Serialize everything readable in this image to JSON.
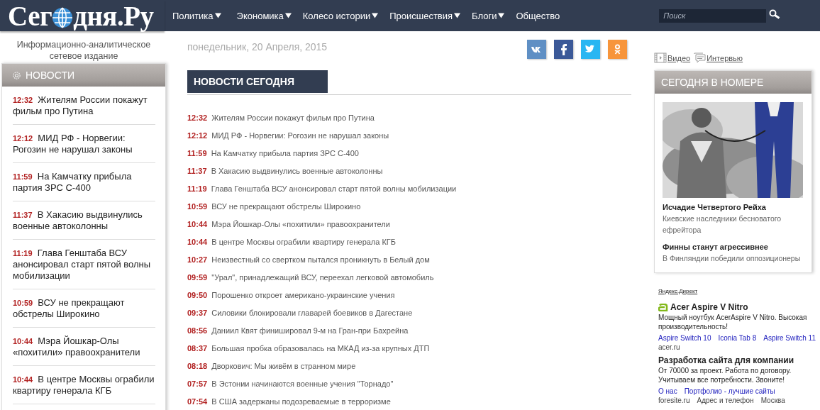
{
  "header": {
    "logo": {
      "before": "Сег",
      "after": "дня.Ру"
    },
    "nav": [
      {
        "label": "Политика",
        "dropdown": true
      },
      {
        "label": "Экономика",
        "dropdown": true
      },
      {
        "label": "Колесо истории",
        "dropdown": true
      },
      {
        "label": "Происшествия",
        "dropdown": true
      },
      {
        "label": "Блоги",
        "dropdown": true
      },
      {
        "label": "Общество",
        "dropdown": false
      }
    ],
    "search": {
      "placeholder": "Поиск"
    }
  },
  "tagline": "Информационно-аналитическое сетевое издание",
  "sidebar": {
    "title": "НОВОСТИ",
    "items": [
      {
        "time": "12:32",
        "title": "Жителям России покажут фильм про Путина"
      },
      {
        "time": "12:12",
        "title": "МИД РФ - Норвегии: Рогозин не нарушал законы"
      },
      {
        "time": "11:59",
        "title": "На Камчатку прибыла партия ЗРС С-400"
      },
      {
        "time": "11:37",
        "title": "В Хакасию выдвинулись военные автоколонны"
      },
      {
        "time": "11:19",
        "title": "Глава Генштаба ВСУ анонсировал старт пятой волны мобилизации"
      },
      {
        "time": "10:59",
        "title": "ВСУ не прекращают обстрелы Широкино"
      },
      {
        "time": "10:44",
        "title": "Мэра Йошкар-Олы «похитили» правоохранители"
      },
      {
        "time": "10:44",
        "title": "В центре Москвы ограбили квартиру генерала КГБ"
      }
    ]
  },
  "date": "понедельник, 20 Апреля, 2015",
  "social": [
    {
      "kind": "vk"
    },
    {
      "kind": "facebook"
    },
    {
      "kind": "twitter"
    },
    {
      "kind": "odnoklassniki"
    }
  ],
  "news": {
    "title": "НОВОСТИ СЕГОДНЯ",
    "items": [
      {
        "time": "12:32",
        "title": "Жителям России покажут фильм про Путина"
      },
      {
        "time": "12:12",
        "title": "МИД РФ - Норвегии: Рогозин не нарушал законы"
      },
      {
        "time": "11:59",
        "title": "На Камчатку прибыла партия ЗРС С-400"
      },
      {
        "time": "11:37",
        "title": "В Хакасию выдвинулись военные автоколонны"
      },
      {
        "time": "11:19",
        "title": "Глава Генштаба ВСУ анонсировал старт пятой волны мобилизации"
      },
      {
        "time": "10:59",
        "title": "ВСУ не прекращают обстрелы Широкино"
      },
      {
        "time": "10:44",
        "title": "Мэра Йошкар-Олы «похитили» правоохранители"
      },
      {
        "time": "10:44",
        "title": "В центре Москвы ограбили квартиру генерала КГБ"
      },
      {
        "time": "10:27",
        "title": "Неизвестный со свертком пытался проникнуть в Белый дом"
      },
      {
        "time": "09:59",
        "title": "\"Урал\", принадлежащий ВСУ, переехал легковой автомобиль"
      },
      {
        "time": "09:50",
        "title": "Порошенко откроет американо-украинские учения"
      },
      {
        "time": "09:37",
        "title": "Силовики блокировали главарей боевиков в Дагестане"
      },
      {
        "time": "08:56",
        "title": "Даниил Квят финишировал 9-м на Гран-при Бахрейна"
      },
      {
        "time": "08:37",
        "title": "Большая пробка образовалась на МКАД из-за крупных ДТП"
      },
      {
        "time": "08:18",
        "title": "Дворкович: Мы живём в странном мире"
      },
      {
        "time": "07:57",
        "title": "В Эстонии начинаются военные учения \"Торнадо\""
      },
      {
        "time": "07:54",
        "title": "В США задержаны подозреваемые в терроризме"
      }
    ]
  },
  "media_links": [
    {
      "kind": "video",
      "label": "Видео"
    },
    {
      "kind": "interview",
      "label": "Интервью"
    }
  ],
  "issue": {
    "title": "СЕГОДНЯ В НОМЕРЕ",
    "articles": [
      {
        "title": "Исчадие Четвертого Рейха",
        "subtitle": "Киевские наследники бесноватого ефрейтора"
      },
      {
        "title": "Финны станут агрессивнее",
        "subtitle": "В Финляндии победили оппозиционеры"
      }
    ]
  },
  "ads": {
    "label": "Яндекс.Директ",
    "items": [
      {
        "has_logo": true,
        "title": "Acer Aspire V Nitro",
        "text": "Мощный ноутбук AcerAspire V Nitro. Высокая производительность!",
        "links": [
          "Aspire Switch 10",
          "Iconia Tab 8",
          "Aspire Switch 11"
        ],
        "footer": [
          "acer.ru"
        ]
      },
      {
        "has_logo": false,
        "title": "Разработка сайта для компании",
        "text": "От 70000 за проект. Работа по договору. Учитываем все потребности. Звоните!",
        "links": [
          "О нас",
          "Портфолио - лучшие сайты"
        ],
        "footer": [
          "foresite.ru",
          "Адрес и телефон",
          "Москва"
        ]
      }
    ]
  }
}
